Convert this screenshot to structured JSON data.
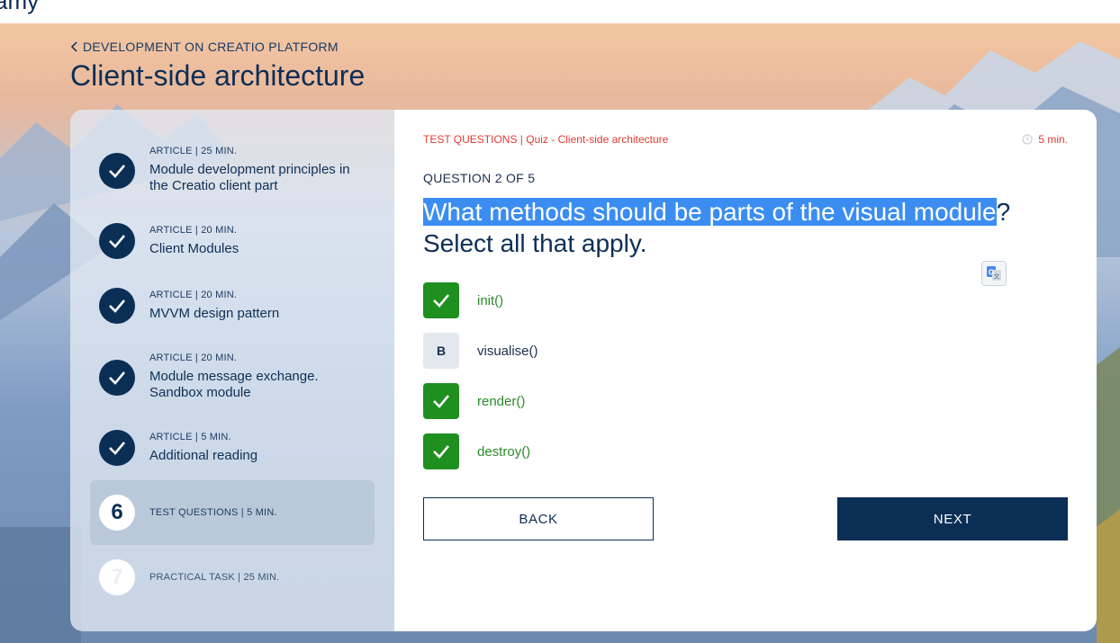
{
  "topbar": {
    "logo_fragment": "amy"
  },
  "breadcrumb": {
    "label": "DEVELOPMENT ON CREATIO PLATFORM"
  },
  "page": {
    "title": "Client-side architecture"
  },
  "sidebar": {
    "items": [
      {
        "meta": "ARTICLE | 25 MIN.",
        "title": "Module development principles in the Creatio client part",
        "status": "done"
      },
      {
        "meta": "ARTICLE | 20 MIN.",
        "title": "Client Modules",
        "status": "done"
      },
      {
        "meta": "ARTICLE | 20 MIN.",
        "title": "MVVM design pattern",
        "status": "done"
      },
      {
        "meta": "ARTICLE | 20 MIN.",
        "title": "Module message exchange. Sandbox module",
        "status": "done"
      },
      {
        "meta": "ARTICLE | 5 MIN.",
        "title": "Additional reading",
        "status": "done"
      },
      {
        "number": "6",
        "meta": "TEST QUESTIONS | 5 MIN.",
        "status": "active"
      },
      {
        "number": "7",
        "meta": "PRACTICAL TASK | 25 MIN.",
        "status": "locked"
      }
    ]
  },
  "quiz": {
    "crumb": "TEST QUESTIONS | Quiz - Client-side architecture",
    "duration": "5 min.",
    "counter": "QUESTION 2 OF 5",
    "question_highlighted": "What methods should be parts of the visual module",
    "question_rest": "? Select all that apply.",
    "answers": [
      {
        "label": "init()",
        "state": "correct",
        "icon": "checkmark-icon"
      },
      {
        "letter": "B",
        "label": "visualise()",
        "state": "neutral"
      },
      {
        "label": "render()",
        "state": "correct",
        "icon": "checkmark-icon"
      },
      {
        "label": "destroy()",
        "state": "correct",
        "icon": "checkmark-icon"
      }
    ],
    "back_label": "BACK",
    "next_label": "NEXT"
  },
  "colors": {
    "navy": "#0b2e55",
    "accent_red": "#e03a2f",
    "correct_green": "#1f8f1f",
    "highlight_blue": "#3b8df2"
  }
}
